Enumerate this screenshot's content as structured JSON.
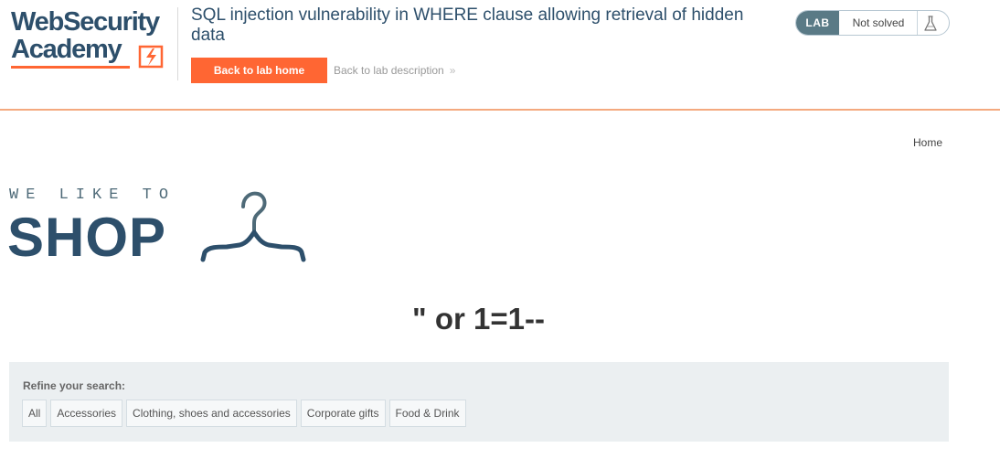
{
  "header": {
    "logo": {
      "line1": "WebSecurity",
      "line2": "Academy"
    },
    "lab_title": "SQL injection vulnerability in WHERE clause allowing retrieval of hidden data",
    "back_home_label": "Back to lab home",
    "back_description_label": "Back to lab description",
    "back_description_chevron": "»",
    "badge": {
      "lab_label": "LAB",
      "status_label": "Not solved"
    },
    "colors": {
      "brand": "#2d4f6b",
      "accent": "#ff6633",
      "badge_lab_bg": "#5a7a86"
    }
  },
  "nav": {
    "home_label": "Home"
  },
  "shop_logo": {
    "tagline": "WE LIKE TO",
    "word": "SHOP"
  },
  "search": {
    "term": "\" or 1=1--"
  },
  "filters": {
    "label": "Refine your search:",
    "categories": [
      "All",
      "Accessories",
      "Clothing, shoes and accessories",
      "Corporate gifts",
      "Food & Drink"
    ]
  }
}
